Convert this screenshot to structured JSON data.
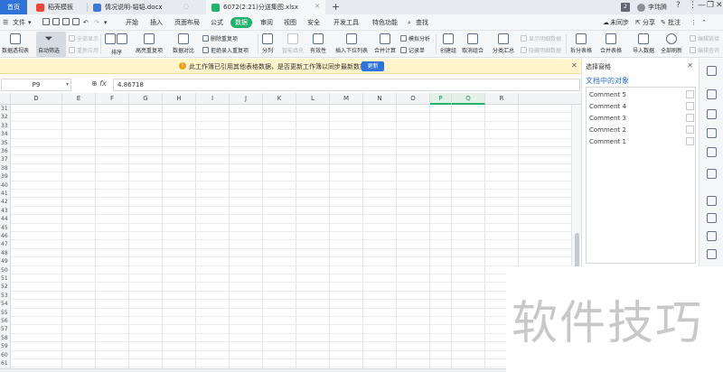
{
  "titlebar": {
    "home_label": "首页",
    "tabs": [
      {
        "label": "稻壳模板"
      },
      {
        "label": "情况说明-韬韬.docx"
      },
      {
        "label": "6072(2.21)分送集图.xlsx"
      }
    ],
    "new_tab": "+",
    "badge_count": "2",
    "user_name": "李玮腾",
    "window_buttons": [
      "?",
      "⋮",
      "—",
      "❐",
      "✕"
    ]
  },
  "menubar": {
    "file": "文件",
    "items": [
      "开始",
      "插入",
      "页面布局",
      "公式",
      "数据",
      "审阅",
      "视图",
      "安全",
      "开发工具",
      "特色功能"
    ],
    "active": "数据",
    "search": "查找",
    "sync": "未同步",
    "share": "分享",
    "comment": "批注"
  },
  "ribbon": {
    "pivot": "数据透视表",
    "autofilter": "自动筛选",
    "show_all": "全部显示",
    "reapply": "重新应用",
    "sort": "排序",
    "highlight_dup": "高亮重复项",
    "compare": "数据对比",
    "remove_dup": "删除重复项",
    "reject_dup": "拒绝录入重复项",
    "split": "分列",
    "smart_fill": "智能填充",
    "validity": "有效性",
    "dropdown": "插入下拉列表",
    "merge_calc": "合并计算",
    "simulate": "模拟分析",
    "record": "记录单",
    "group": "创建组",
    "ungroup": "取消组合",
    "subtotal": "分类汇总",
    "show_detail": "显示明细数据",
    "hide_detail": "隐藏明细数据",
    "split_table": "拆分表格",
    "merge_table": "合并表格",
    "import": "导入数据",
    "refresh_all": "全部刷新",
    "edit_links": "编辑链接",
    "edit_query": "编辑查询"
  },
  "notice": {
    "text": "此工作簿已引用其他表格数据，是否更新工作簿以同步最新数据？",
    "update_button": "更新"
  },
  "formula": {
    "cell_ref": "P9",
    "fx": "fx",
    "value": "4.86718"
  },
  "grid": {
    "columns": [
      "D",
      "E",
      "F",
      "G",
      "H",
      "I",
      "J",
      "K",
      "L",
      "M",
      "N",
      "O",
      "P",
      "Q",
      "R"
    ],
    "selected_columns": [
      "P",
      "Q"
    ],
    "rows": [
      "31",
      "32",
      "33",
      "34",
      "35",
      "36",
      "37",
      "38",
      "39",
      "40",
      "41",
      "42",
      "43",
      "44",
      "45",
      "46",
      "47",
      "48",
      "49",
      "50",
      "51",
      "52",
      "53",
      "54",
      "55",
      "56",
      "57",
      "58",
      "59",
      "60",
      "61"
    ]
  },
  "pane": {
    "title": "选择窗格",
    "subtitle": "文档中的对象",
    "items": [
      "Comment 5",
      "Comment 4",
      "Comment 3",
      "Comment 2",
      "Comment 1"
    ]
  },
  "watermark": "软件技巧",
  "colors": {
    "accent_green": "#23b26d",
    "accent_blue": "#2f72d8",
    "notice_bg": "#fff4cc"
  }
}
